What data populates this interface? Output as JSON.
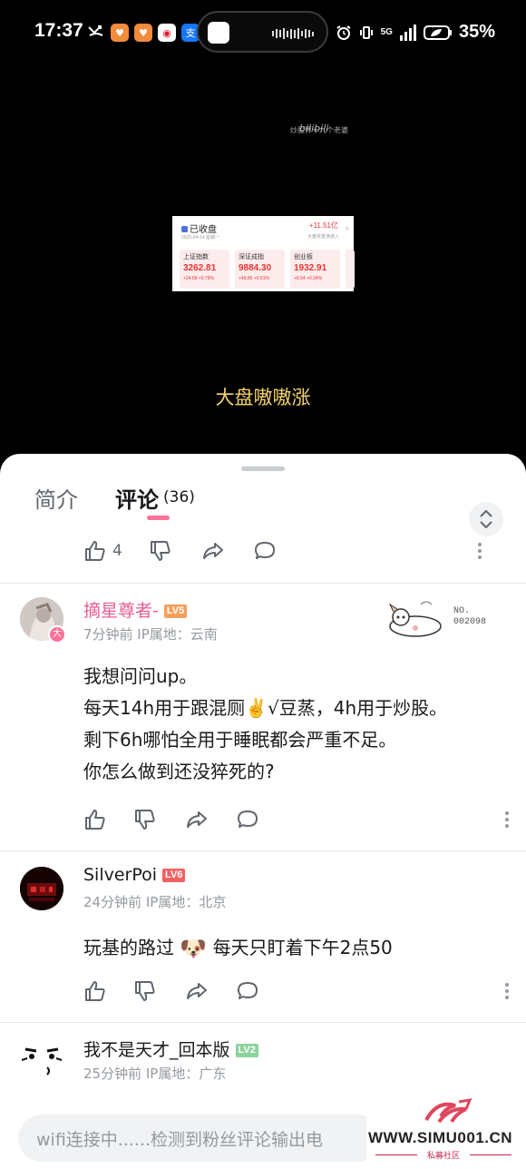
{
  "status_bar": {
    "time": "17:37",
    "network": "5G",
    "battery": "35%"
  },
  "video": {
    "watermark": "炒股界十九个老婆",
    "platform": "bilibili",
    "subtitle": "大盘嗷嗷涨",
    "market_card": {
      "title": "已收盘",
      "date": "2025-04-14 星期一",
      "net_flow": "+11.51亿",
      "net_flow_label": "大盘资金净流入",
      "indices": [
        {
          "name": "上证指数",
          "value": "3262.81",
          "change": "+24.58",
          "pct": "+0.76%"
        },
        {
          "name": "深证成指",
          "value": "9884.30",
          "change": "+49.86",
          "pct": "+0.51%"
        },
        {
          "name": "创业板",
          "value": "1932.91",
          "change": "+6.54",
          "pct": "+0.34%"
        }
      ]
    }
  },
  "tabs": {
    "intro": "简介",
    "comments": "评论",
    "comment_count": "(36)"
  },
  "top_actions": {
    "like_count": "4"
  },
  "comments": [
    {
      "username": "摘星尊者-",
      "level": "LV5",
      "avatar_badge": "大",
      "meta": "7分钟前 IP属地：云南",
      "decoration_no_label": "NO.",
      "decoration_no": "002098",
      "lines": [
        "我想问问up。",
        "每天14h用于跟混厕✌️√豆蒸，4h用于炒股。",
        "剩下6h哪怕全用于睡眠都会严重不足。",
        "你怎么做到还没猝死的?"
      ]
    },
    {
      "username": "SilverPoi",
      "level": "LV6",
      "meta": "24分钟前 IP属地：北京",
      "text_before": "玩基的路过",
      "emoji": "🐶",
      "text_after": "每天只盯着下午2点50"
    },
    {
      "username": "我不是天才_回本版",
      "level": "LV2",
      "meta": "25分钟前 IP属地：广东"
    }
  ],
  "input": {
    "text": "wifi连接中......检测到粉丝评论输出电"
  },
  "site_watermark": {
    "url": "WWW.SIMU001.CN",
    "subtitle": "私募社区"
  },
  "colors": {
    "accent_pink": "#fb7299",
    "username_pink": "#e85d94",
    "lv5": "#f6a05b",
    "lv6": "#f36262",
    "lv2": "#8bd29b",
    "subtitle_yellow": "#f5d36b"
  }
}
